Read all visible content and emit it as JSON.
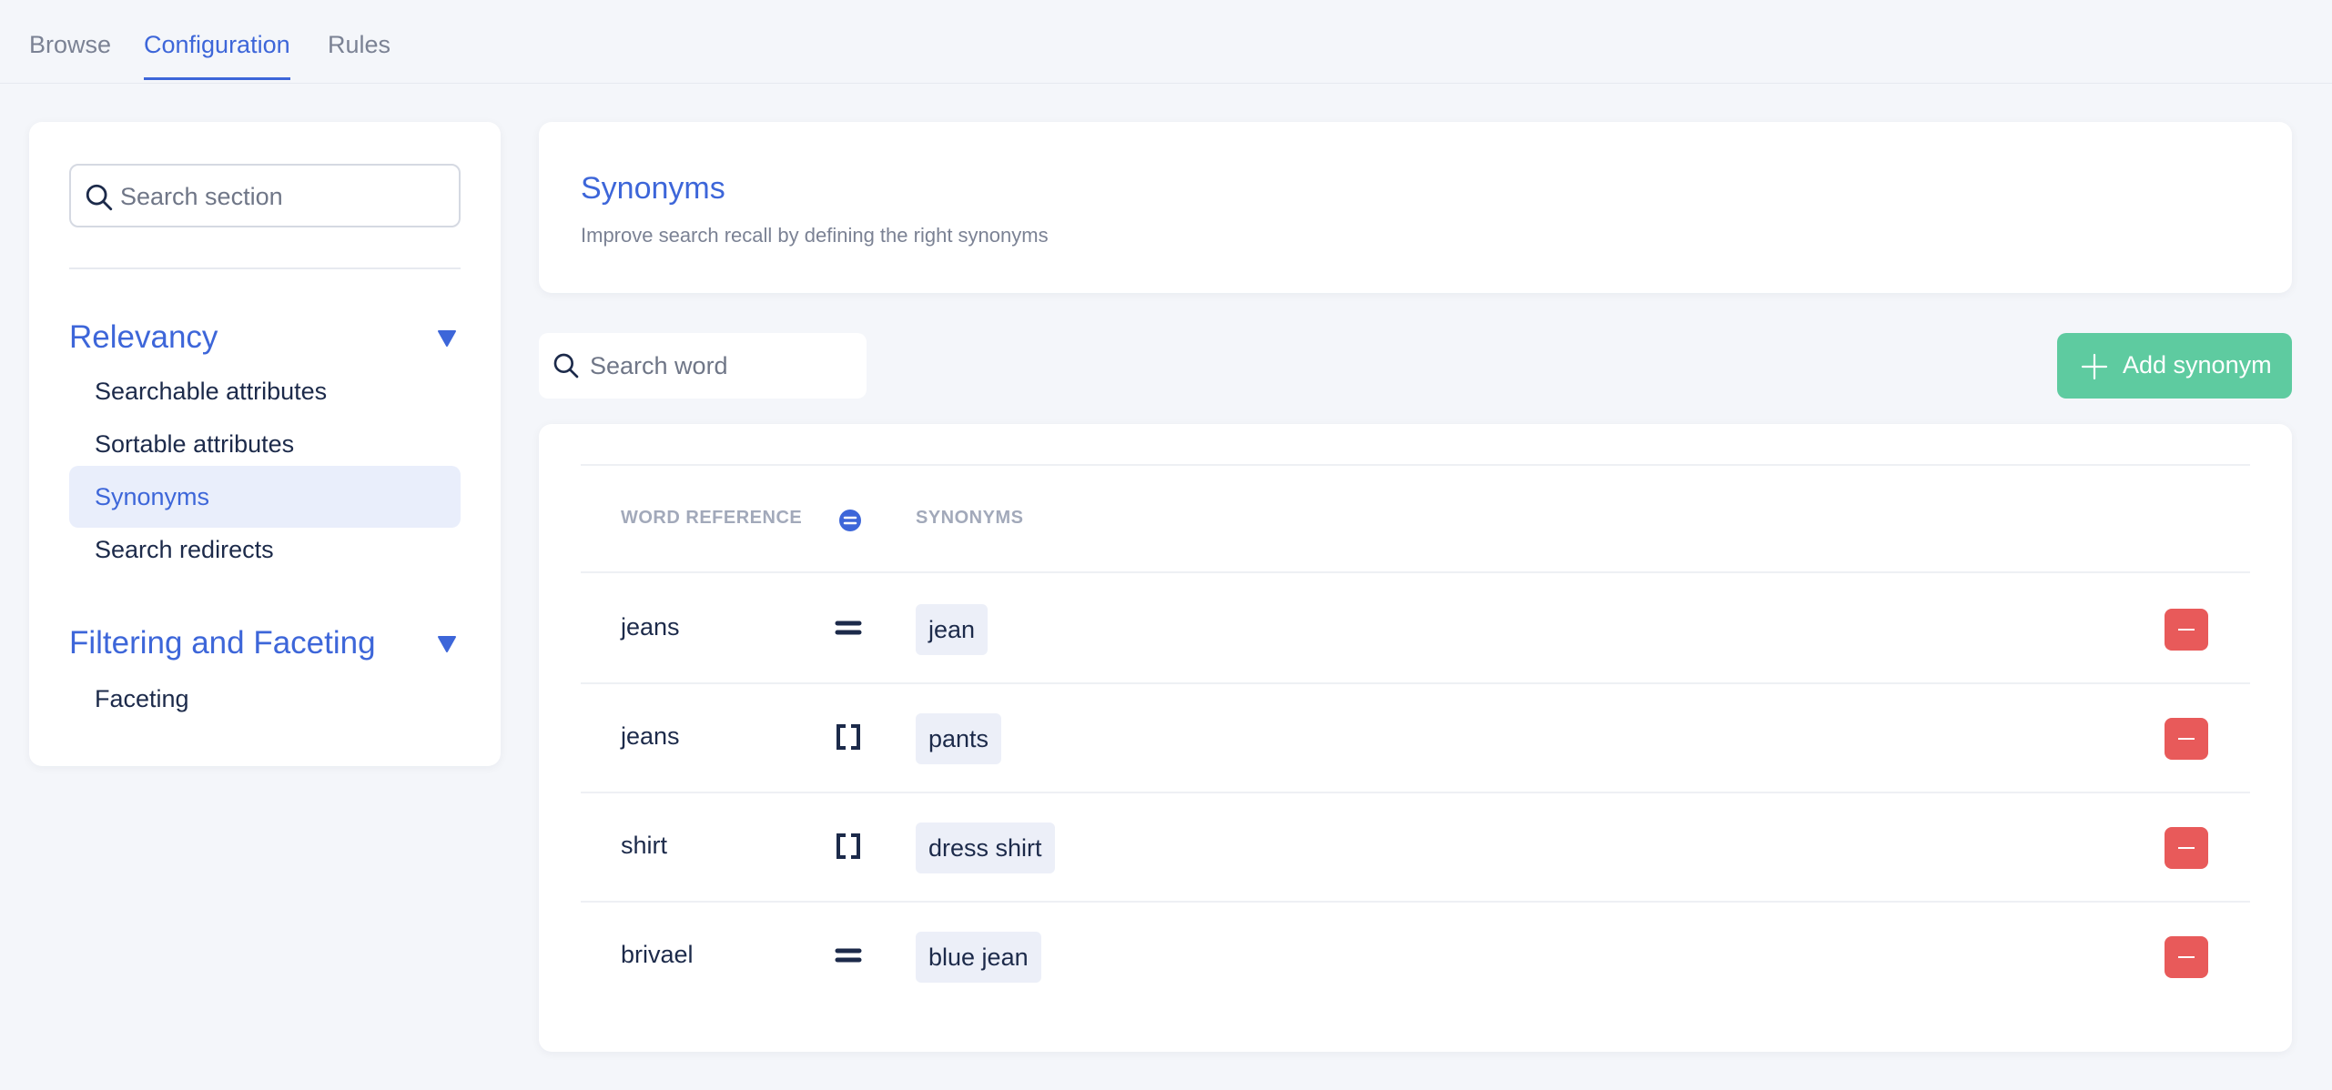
{
  "tabs": [
    {
      "label": "Browse",
      "active": false
    },
    {
      "label": "Configuration",
      "active": true
    },
    {
      "label": "Rules",
      "active": false
    }
  ],
  "sidebar": {
    "search_placeholder": "Search section",
    "sections": [
      {
        "title": "Relevancy",
        "items": [
          {
            "label": "Searchable attributes",
            "active": false
          },
          {
            "label": "Sortable attributes",
            "active": false
          },
          {
            "label": "Synonyms",
            "active": true
          },
          {
            "label": "Search redirects",
            "active": false
          }
        ]
      },
      {
        "title": "Filtering and Faceting",
        "items": [
          {
            "label": "Faceting",
            "active": false
          }
        ]
      }
    ]
  },
  "header": {
    "title": "Synonyms",
    "subtitle": "Improve search recall by defining the right synonyms"
  },
  "toolbar": {
    "search_placeholder": "Search word",
    "add_label": "Add synonym"
  },
  "table": {
    "columns": {
      "word": "WORD REFERENCE",
      "synonyms": "SYNONYMS"
    },
    "rows": [
      {
        "word": "jeans",
        "type": "equal",
        "synonym": "jean"
      },
      {
        "word": "jeans",
        "type": "bracket",
        "synonym": "pants"
      },
      {
        "word": "shirt",
        "type": "bracket",
        "synonym": "dress shirt"
      },
      {
        "word": "brivael",
        "type": "equal",
        "synonym": "blue jean"
      }
    ]
  },
  "colors": {
    "accent": "#3d66d9",
    "success": "#5ecba0",
    "danger": "#e85a5a",
    "chip": "#eceff8"
  },
  "icons": {
    "search": "search-icon",
    "caret": "caret-down-icon",
    "plus": "plus-icon",
    "equal": "equal-icon",
    "bracket": "bracket-icon",
    "minus": "minus-icon"
  }
}
